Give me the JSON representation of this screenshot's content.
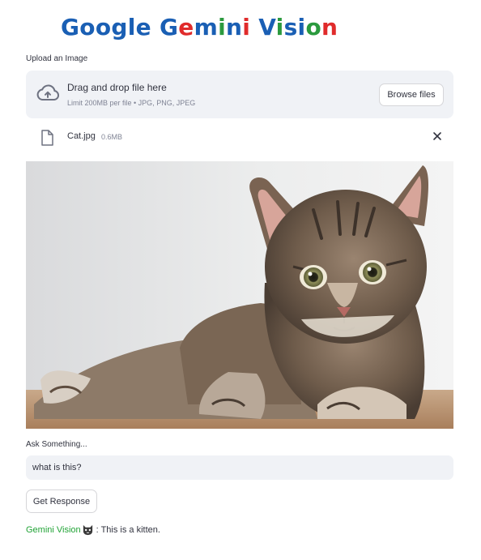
{
  "title": {
    "parts": [
      {
        "text": "G",
        "color": "#1a5fb4"
      },
      {
        "text": "o",
        "color": "#1a5fb4"
      },
      {
        "text": "o",
        "color": "#1a5fb4"
      },
      {
        "text": "g",
        "color": "#1a5fb4"
      },
      {
        "text": "l",
        "color": "#1a5fb4"
      },
      {
        "text": "e",
        "color": "#1a5fb4"
      },
      {
        "text": " ",
        "color": "#1a5fb4"
      },
      {
        "text": "G",
        "color": "#1a5fb4"
      },
      {
        "text": "e",
        "color": "#e02b2b"
      },
      {
        "text": "m",
        "color": "#1a5fb4"
      },
      {
        "text": "i",
        "color": "#2b9a3e"
      },
      {
        "text": "n",
        "color": "#1a5fb4"
      },
      {
        "text": "i",
        "color": "#e02b2b"
      },
      {
        "text": " ",
        "color": "#1a5fb4"
      },
      {
        "text": "V",
        "color": "#1a5fb4"
      },
      {
        "text": "i",
        "color": "#2b9a3e"
      },
      {
        "text": "s",
        "color": "#1a5fb4"
      },
      {
        "text": "i",
        "color": "#1a5fb4"
      },
      {
        "text": "o",
        "color": "#2b9a3e"
      },
      {
        "text": "n",
        "color": "#e02b2b"
      }
    ]
  },
  "uploader": {
    "label": "Upload an Image",
    "drop_text": "Drag and drop file here",
    "limit_text": "Limit 200MB per file • JPG, PNG, JPEG",
    "browse_label": "Browse files",
    "cloud_icon": "cloud-upload-icon"
  },
  "file": {
    "name": "Cat.jpg",
    "size": "0.6MB",
    "icon": "file-icon",
    "close_icon": "close-icon"
  },
  "ask": {
    "label": "Ask Something...",
    "value": "what is this?"
  },
  "button": {
    "label": "Get Response"
  },
  "answer": {
    "source": "Gemini Vision",
    "text": ": This is a kitten.",
    "emoji_icon": "cat-face-icon"
  },
  "colors": {
    "accent_green": "#21a336",
    "panel_bg": "#f0f2f6"
  }
}
